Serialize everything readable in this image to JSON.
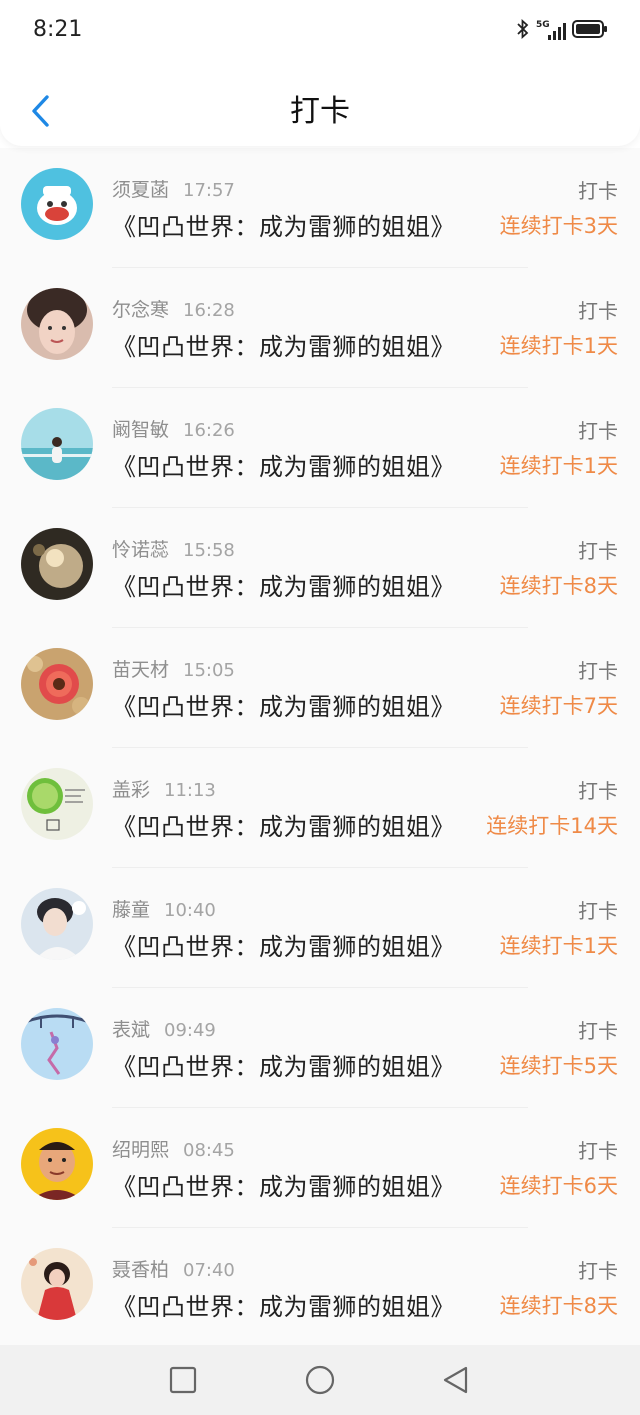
{
  "status": {
    "time": "8:21",
    "signal": "5G"
  },
  "header": {
    "title": "打卡"
  },
  "items": [
    {
      "name": "须夏菡",
      "time": "17:57",
      "book": "《凹凸世界：成为雷狮的姐姐》",
      "tag": "打卡",
      "streak": "连续打卡3天"
    },
    {
      "name": "尔念寒",
      "time": "16:28",
      "book": "《凹凸世界：成为雷狮的姐姐》",
      "tag": "打卡",
      "streak": "连续打卡1天"
    },
    {
      "name": "阚智敏",
      "time": "16:26",
      "book": "《凹凸世界：成为雷狮的姐姐》",
      "tag": "打卡",
      "streak": "连续打卡1天"
    },
    {
      "name": "怜诺蕊",
      "time": "15:58",
      "book": "《凹凸世界：成为雷狮的姐姐》",
      "tag": "打卡",
      "streak": "连续打卡8天"
    },
    {
      "name": "苗天材",
      "time": "15:05",
      "book": "《凹凸世界：成为雷狮的姐姐》",
      "tag": "打卡",
      "streak": "连续打卡7天"
    },
    {
      "name": "盖彩",
      "time": "11:13",
      "book": "《凹凸世界：成为雷狮的姐姐》",
      "tag": "打卡",
      "streak": "连续打卡14天"
    },
    {
      "name": "藤童",
      "time": "10:40",
      "book": "《凹凸世界：成为雷狮的姐姐》",
      "tag": "打卡",
      "streak": "连续打卡1天"
    },
    {
      "name": "表斌",
      "time": "09:49",
      "book": "《凹凸世界：成为雷狮的姐姐》",
      "tag": "打卡",
      "streak": "连续打卡5天"
    },
    {
      "name": "绍明熙",
      "time": "08:45",
      "book": "《凹凸世界：成为雷狮的姐姐》",
      "tag": "打卡",
      "streak": "连续打卡6天"
    },
    {
      "name": "聂香柏",
      "time": "07:40",
      "book": "《凹凸世界：成为雷狮的姐姐》",
      "tag": "打卡",
      "streak": "连续打卡8天"
    }
  ],
  "icons": {
    "back": "chevron-left-icon",
    "bluetooth": "bluetooth-icon",
    "signal": "signal-icon",
    "battery": "battery-icon",
    "nav_recent": "square-icon",
    "nav_home": "circle-icon",
    "nav_back": "triangle-back-icon"
  },
  "colors": {
    "accent": "#1e88e5",
    "streak": "#ef8a47",
    "muted": "#8e8e8e"
  }
}
